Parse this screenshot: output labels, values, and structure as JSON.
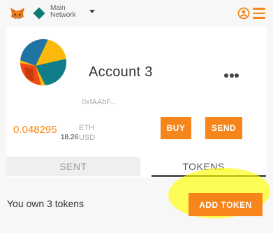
{
  "header": {
    "logo_icon": "metamask-fox-icon",
    "network_icon": "network-diamond-icon",
    "network_label": "Main Network",
    "accounts_icon": "account-switch-icon",
    "menu_icon": "hamburger-menu-icon"
  },
  "account": {
    "name": "Account 3",
    "address": "0xfAAbF...",
    "avatar_icon": "identicon-avatar",
    "more_icon": "more-options-icon"
  },
  "balance": {
    "eth": "0.048295",
    "eth_unit": "ETH",
    "usd": "18.26",
    "usd_unit": "USD"
  },
  "buttons": {
    "buy": "BUY",
    "send": "SEND",
    "add_token": "ADD TOKEN"
  },
  "tabs": [
    {
      "label": "SENT",
      "active": false
    },
    {
      "label": "TOKENS",
      "active": true
    }
  ],
  "tokens": {
    "own_text": "You own 3 tokens"
  },
  "colors": {
    "accent": "#f6851b",
    "network": "#0c7b74",
    "highlight": "#ffff00"
  }
}
